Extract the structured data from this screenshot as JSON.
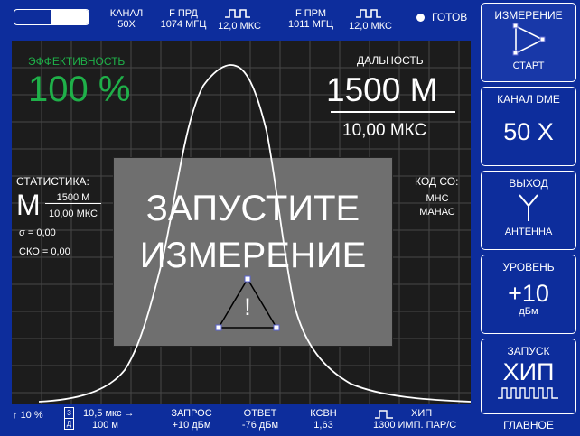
{
  "top": {
    "channel_label": "КАНАЛ",
    "channel_value": "50X",
    "f_tx_label": "F ПРД",
    "f_tx_value": "1074 МГЦ",
    "pulse_tx_value": "12,0 МКС",
    "f_rx_label": "F ПРМ",
    "f_rx_value": "1011 МГЦ",
    "pulse_rx_value": "12,0 МКС",
    "ready_label": "ГОТОВ",
    "battery_level": 0.5
  },
  "screen": {
    "efficiency_label": "ЭФФЕКТИВНОСТЬ",
    "efficiency_value": "100 %",
    "distance_label": "ДАЛЬНОСТЬ",
    "distance_value": "1500 М",
    "distance_time": "10,00 МКС",
    "stats_label": "СТАТИСТИКА:",
    "stats_symbol": "M",
    "stats_top": "1500 М",
    "stats_bottom": "10,00 МКС",
    "sigma": "σ = 0,00",
    "sko": "СКО = 0,00",
    "code_label": "КОД СО:",
    "code_line1": "МНС",
    "code_line2": "МАНАС",
    "overlay_line1": "ЗАПУСТИТЕ",
    "overlay_line2": "ИЗМЕРЕНИЕ",
    "warning_mark": "!"
  },
  "bottom": {
    "threshold": "10 %",
    "icon_box_top": "З",
    "icon_box_bottom": "Д",
    "delay_value": "10,5 мкс",
    "delay_dist": "100 м",
    "request_label": "ЗАПРОС",
    "request_value": "+10 дБм",
    "answer_label": "ОТВЕТ",
    "answer_value": "-76 дБм",
    "vswr_label": "КСВН",
    "vswr_value": "1,63",
    "chaos_label": "ХИП",
    "chaos_value": "1300 ИМП. ПАР/С"
  },
  "side": {
    "measure_title": "ИЗМЕРЕНИЕ",
    "measure_action": "СТАРТ",
    "channel_title": "КАНАЛ DME",
    "channel_value": "50 X",
    "output_title": "ВЫХОД",
    "output_value": "АНТЕННА",
    "level_title": "УРОВЕНЬ",
    "level_value": "+10",
    "level_unit": "дБм",
    "launch_title": "ЗАПУСК",
    "launch_value": "ХИП",
    "main_label": "ГЛАВНОЕ"
  },
  "colors": {
    "background": "#0d2d9c",
    "screen": "#1c1c1c",
    "accent_green": "#1fb049",
    "overlay": "#6f6f6f"
  }
}
